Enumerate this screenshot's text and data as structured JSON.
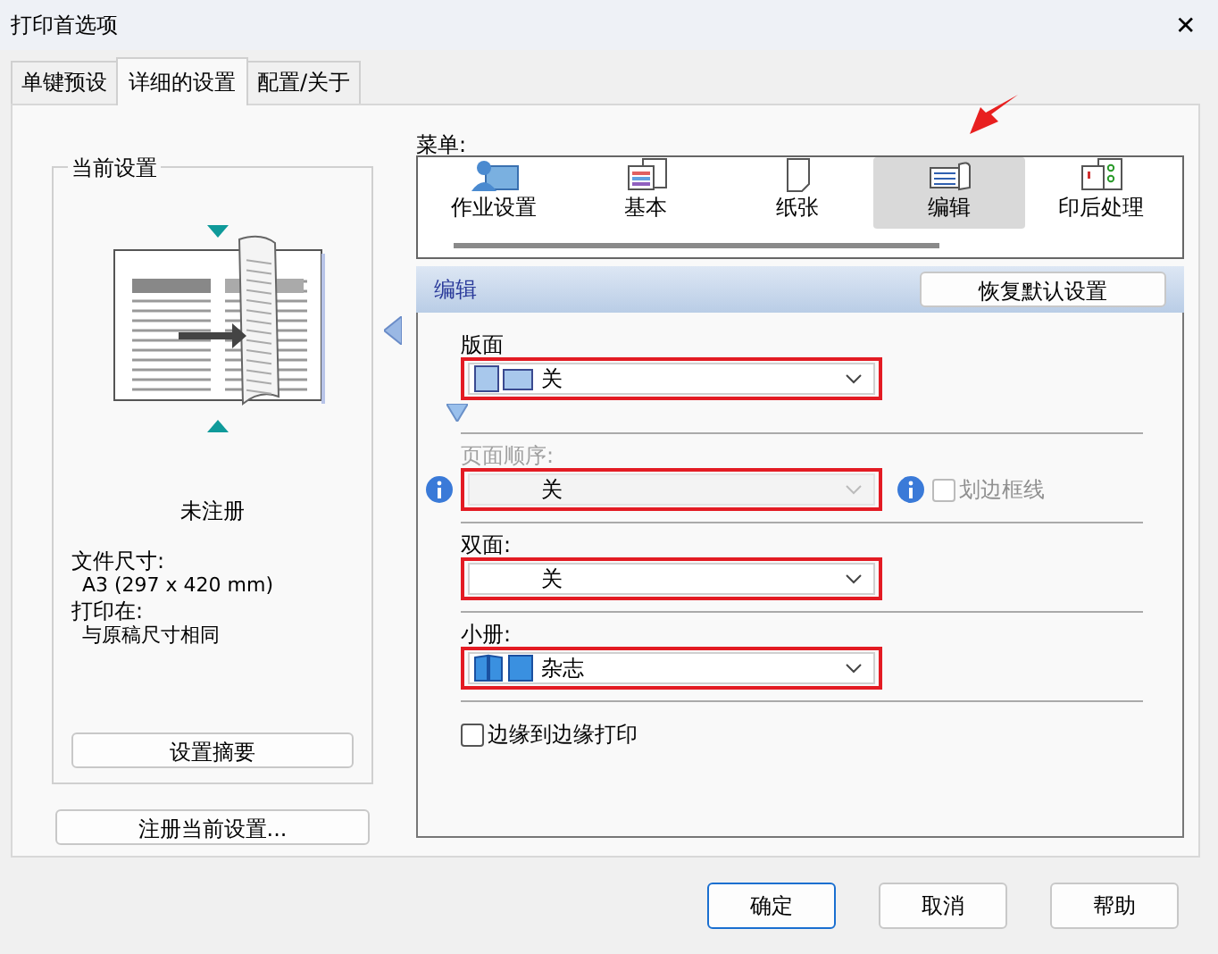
{
  "window": {
    "title": "打印首选项",
    "close": "✕"
  },
  "tabs": [
    {
      "label": "单键预设",
      "selected": false
    },
    {
      "label": "详细的设置",
      "selected": true
    },
    {
      "label": "配置/关于",
      "selected": false
    }
  ],
  "current_settings": {
    "title": "当前设置",
    "status": "未注册",
    "lines": [
      {
        "kind": "label",
        "text": "文件尺寸:"
      },
      {
        "kind": "value",
        "text": "A3 (297 x 420 mm)"
      },
      {
        "kind": "label",
        "text": "打印在:"
      },
      {
        "kind": "value",
        "text": "与原稿尺寸相同"
      }
    ],
    "summary_button": "设置摘要"
  },
  "register_button": "注册当前设置...",
  "menu": {
    "label": "菜单:",
    "items": [
      {
        "label": "作业设置",
        "selected": false
      },
      {
        "label": "基本",
        "selected": false
      },
      {
        "label": "纸张",
        "selected": false
      },
      {
        "label": "编辑",
        "selected": true
      },
      {
        "label": "印后处理",
        "selected": false
      }
    ]
  },
  "section": {
    "title": "编辑",
    "reset_button": "恢复默认设置"
  },
  "fields": [
    {
      "kind": "dropdown",
      "label": "版面",
      "value": "关",
      "disabled": false,
      "highlighted": true
    },
    {
      "kind": "dropdown",
      "label": "页面顺序:",
      "value": "关",
      "disabled": true,
      "highlighted": true,
      "side_checkbox": {
        "label": "划边框线",
        "checked": false,
        "disabled": true
      }
    },
    {
      "kind": "dropdown",
      "label": "双面:",
      "value": "关",
      "disabled": false,
      "highlighted": true
    },
    {
      "kind": "dropdown",
      "label": "小册:",
      "value": "杂志",
      "disabled": false,
      "highlighted": true
    },
    {
      "kind": "checkbox",
      "label": "边缘到边缘打印",
      "checked": false
    }
  ],
  "buttons": [
    "确定",
    "取消",
    "帮助"
  ]
}
